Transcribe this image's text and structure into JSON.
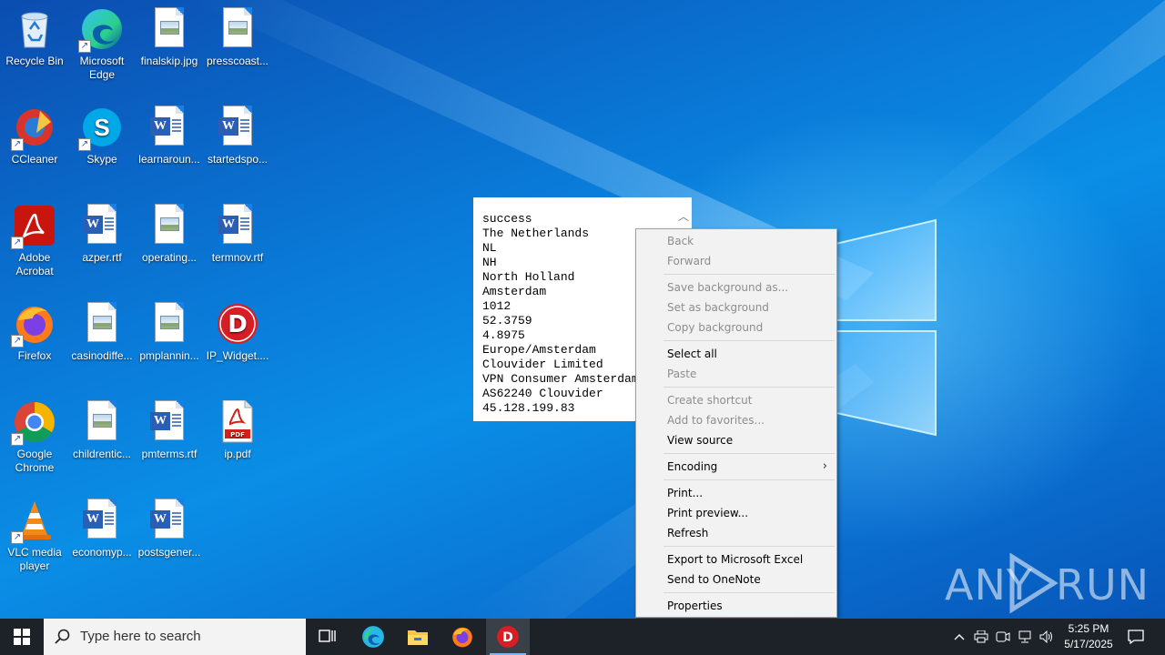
{
  "desktop": {
    "icons": [
      {
        "label": "Recycle Bin",
        "icon": "recycle-bin-icon"
      },
      {
        "label": "Microsoft Edge",
        "icon": "edge-icon"
      },
      {
        "label": "finalskip.jpg",
        "icon": "image-file-icon"
      },
      {
        "label": "presscoast...",
        "icon": "image-file-icon"
      },
      {
        "label": "CCleaner",
        "icon": "ccleaner-icon"
      },
      {
        "label": "Skype",
        "icon": "skype-icon"
      },
      {
        "label": "learnaroun...",
        "icon": "word-doc-icon"
      },
      {
        "label": "startedspo...",
        "icon": "word-doc-icon"
      },
      {
        "label": "Adobe Acrobat",
        "icon": "acrobat-icon"
      },
      {
        "label": "azper.rtf",
        "icon": "word-doc-icon"
      },
      {
        "label": "operating...",
        "icon": "image-file-icon"
      },
      {
        "label": "termnov.rtf",
        "icon": "word-doc-icon"
      },
      {
        "label": "Firefox",
        "icon": "firefox-icon"
      },
      {
        "label": "casinodiffe...",
        "icon": "image-file-icon"
      },
      {
        "label": "pmplannin...",
        "icon": "image-file-icon"
      },
      {
        "label": "IP_Widget....",
        "icon": "ip-widget-icon"
      },
      {
        "label": "Google Chrome",
        "icon": "chrome-icon"
      },
      {
        "label": "childrentic...",
        "icon": "image-file-icon"
      },
      {
        "label": "pmterms.rtf",
        "icon": "word-doc-icon"
      },
      {
        "label": "ip.pdf",
        "icon": "pdf-file-icon"
      },
      {
        "label": "VLC media player",
        "icon": "vlc-icon"
      },
      {
        "label": "economyp...",
        "icon": "word-doc-icon"
      },
      {
        "label": "postsgener...",
        "icon": "word-doc-icon"
      }
    ]
  },
  "text_page": {
    "lines": [
      "success",
      "The Netherlands",
      "NL",
      "NH",
      "North Holland",
      "Amsterdam",
      "1012",
      "52.3759",
      "4.8975",
      "Europe/Amsterdam",
      "Clouvider Limited",
      "VPN Consumer Amsterdam",
      "AS62240 Clouvider",
      "45.128.199.83"
    ]
  },
  "context_menu": {
    "groups": [
      [
        {
          "label": "Back",
          "enabled": false
        },
        {
          "label": "Forward",
          "enabled": false
        }
      ],
      [
        {
          "label": "Save background as...",
          "enabled": false
        },
        {
          "label": "Set as background",
          "enabled": false
        },
        {
          "label": "Copy background",
          "enabled": false
        }
      ],
      [
        {
          "label": "Select all",
          "enabled": true
        },
        {
          "label": "Paste",
          "enabled": false
        }
      ],
      [
        {
          "label": "Create shortcut",
          "enabled": false
        },
        {
          "label": "Add to favorites...",
          "enabled": false
        },
        {
          "label": "View source",
          "enabled": true
        }
      ],
      [
        {
          "label": "Encoding",
          "enabled": true,
          "submenu": true
        }
      ],
      [
        {
          "label": "Print...",
          "enabled": true
        },
        {
          "label": "Print preview...",
          "enabled": true
        },
        {
          "label": "Refresh",
          "enabled": true
        }
      ],
      [
        {
          "label": "Export to Microsoft Excel",
          "enabled": true
        },
        {
          "label": "Send to OneNote",
          "enabled": true
        }
      ],
      [
        {
          "label": "Properties",
          "enabled": true
        }
      ]
    ]
  },
  "watermark": {
    "left": "ANY",
    "right": "RUN"
  },
  "taskbar": {
    "search_placeholder": "Type here to search",
    "pinned": [
      "task-view-icon",
      "edge-icon",
      "file-explorer-icon",
      "firefox-icon",
      "ip-widget-icon"
    ],
    "active": "ip-widget-icon",
    "tray": [
      "chevron-up-icon",
      "printer-icon",
      "meet-now-icon",
      "network-icon",
      "volume-icon"
    ],
    "time": "5:25 PM",
    "date": "5/17/2025"
  },
  "colors": {
    "taskbar": "#1c2228",
    "desktop_accent": "#0a78d6",
    "menu_bg": "#f2f2f2",
    "disabled_text": "#8d8d8d"
  }
}
